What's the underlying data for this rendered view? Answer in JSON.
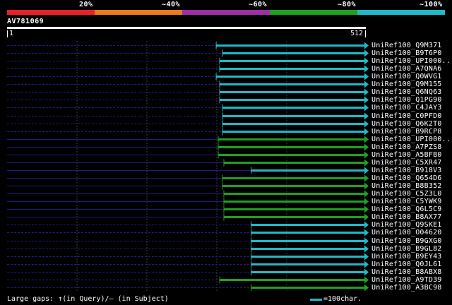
{
  "scale": {
    "labels": [
      "20%",
      "~40%",
      "~60%",
      "~80%",
      "~100%"
    ],
    "colors": [
      "#e8202a",
      "#e97b1e",
      "#9b2fa3",
      "#20a020",
      "#21b9c8"
    ]
  },
  "query": {
    "name": "AV781069",
    "start_label": "1",
    "end_label": "512",
    "length": 512
  },
  "colors": {
    "background": "#000000",
    "guide_line": "#1c1c8a",
    "grid_line": "#3a3a3a",
    "cyan": "#21b9c8",
    "green": "#20a020"
  },
  "hits": [
    {
      "name": "UniRef100_Q9M371",
      "qstart": 300,
      "qend": 512,
      "color_class": "cyan",
      "rule": "dashed"
    },
    {
      "name": "UniRef100_B9T6P0",
      "qstart": 309,
      "qend": 512,
      "color_class": "cyan",
      "rule": "dashed"
    },
    {
      "name": "UniRef100_UPI000..",
      "qstart": 305,
      "qend": 512,
      "color_class": "cyan",
      "rule": "dashed"
    },
    {
      "name": "UniRef100_A7QNA6",
      "qstart": 305,
      "qend": 512,
      "color_class": "cyan",
      "rule": "dashed"
    },
    {
      "name": "UniRef100_Q0WVG1",
      "qstart": 300,
      "qend": 512,
      "color_class": "cyan",
      "rule": "dashed"
    },
    {
      "name": "UniRef100_Q9M155",
      "qstart": 305,
      "qend": 512,
      "color_class": "cyan",
      "rule": "dashed"
    },
    {
      "name": "UniRef100_Q6NQ63",
      "qstart": 305,
      "qend": 512,
      "color_class": "cyan",
      "rule": "dashed"
    },
    {
      "name": "UniRef100_Q1PG90",
      "qstart": 305,
      "qend": 512,
      "color_class": "cyan",
      "rule": "dashed"
    },
    {
      "name": "UniRef100_C4JAY3",
      "qstart": 309,
      "qend": 512,
      "color_class": "cyan",
      "rule": "dashed"
    },
    {
      "name": "UniRef100_C0PFD0",
      "qstart": 309,
      "qend": 512,
      "color_class": "cyan",
      "rule": "dashed"
    },
    {
      "name": "UniRef100_Q6K2T0",
      "qstart": 309,
      "qend": 512,
      "color_class": "cyan",
      "rule": "dashed"
    },
    {
      "name": "UniRef100_B9RCP8",
      "qstart": 309,
      "qend": 512,
      "color_class": "cyan",
      "rule": "dashed"
    },
    {
      "name": "UniRef100_UPI000..",
      "qstart": 303,
      "qend": 512,
      "color_class": "green",
      "rule": "solid"
    },
    {
      "name": "UniRef100_A7PZS8",
      "qstart": 303,
      "qend": 512,
      "color_class": "green",
      "rule": "solid"
    },
    {
      "name": "UniRef100_A5BFB0",
      "qstart": 303,
      "qend": 512,
      "color_class": "green",
      "rule": "solid"
    },
    {
      "name": "UniRef100_C5XR47",
      "qstart": 311,
      "qend": 512,
      "color_class": "green",
      "rule": "solid"
    },
    {
      "name": "UniRef100_B918V3",
      "qstart": 350,
      "qend": 512,
      "color_class": "cyan",
      "rule": "solid"
    },
    {
      "name": "UniRef100_Q654D6",
      "qstart": 309,
      "qend": 512,
      "color_class": "green",
      "rule": "solid"
    },
    {
      "name": "UniRef100_B8B352",
      "qstart": 309,
      "qend": 512,
      "color_class": "green",
      "rule": "solid"
    },
    {
      "name": "UniRef100_C5Z3L0",
      "qstart": 311,
      "qend": 512,
      "color_class": "green",
      "rule": "solid"
    },
    {
      "name": "UniRef100_C5YWK9",
      "qstart": 311,
      "qend": 512,
      "color_class": "green",
      "rule": "solid"
    },
    {
      "name": "UniRef100_Q6L5C9",
      "qstart": 311,
      "qend": 512,
      "color_class": "green",
      "rule": "solid"
    },
    {
      "name": "UniRef100_B8AX77",
      "qstart": 311,
      "qend": 512,
      "color_class": "green",
      "rule": "solid"
    },
    {
      "name": "UniRef100_Q9SKE1",
      "qstart": 350,
      "qend": 512,
      "color_class": "cyan",
      "rule": "dashed"
    },
    {
      "name": "UniRef100_O04620",
      "qstart": 350,
      "qend": 512,
      "color_class": "cyan",
      "rule": "dashed"
    },
    {
      "name": "UniRef100_B9GXG0",
      "qstart": 350,
      "qend": 512,
      "color_class": "cyan",
      "rule": "dashed"
    },
    {
      "name": "UniRef100_B9GL82",
      "qstart": 350,
      "qend": 512,
      "color_class": "cyan",
      "rule": "dashed"
    },
    {
      "name": "UniRef100_B9EY43",
      "qstart": 350,
      "qend": 512,
      "color_class": "cyan",
      "rule": "dashed"
    },
    {
      "name": "UniRef100_Q0JL61",
      "qstart": 350,
      "qend": 512,
      "color_class": "cyan",
      "rule": "dashed"
    },
    {
      "name": "UniRef100_B8ABX8",
      "qstart": 350,
      "qend": 512,
      "color_class": "cyan",
      "rule": "dashed"
    },
    {
      "name": "UniRef100_A9TD39",
      "qstart": 305,
      "qend": 512,
      "color_class": "green",
      "rule": "dashed"
    },
    {
      "name": "UniRef100_A3BC98",
      "qstart": 350,
      "qend": 512,
      "color_class": "green",
      "rule": "dashed"
    }
  ],
  "legend": {
    "gaps_text": "Large gaps: ↑(in Query)/– (in Subject)",
    "scale_text": "=100char."
  }
}
